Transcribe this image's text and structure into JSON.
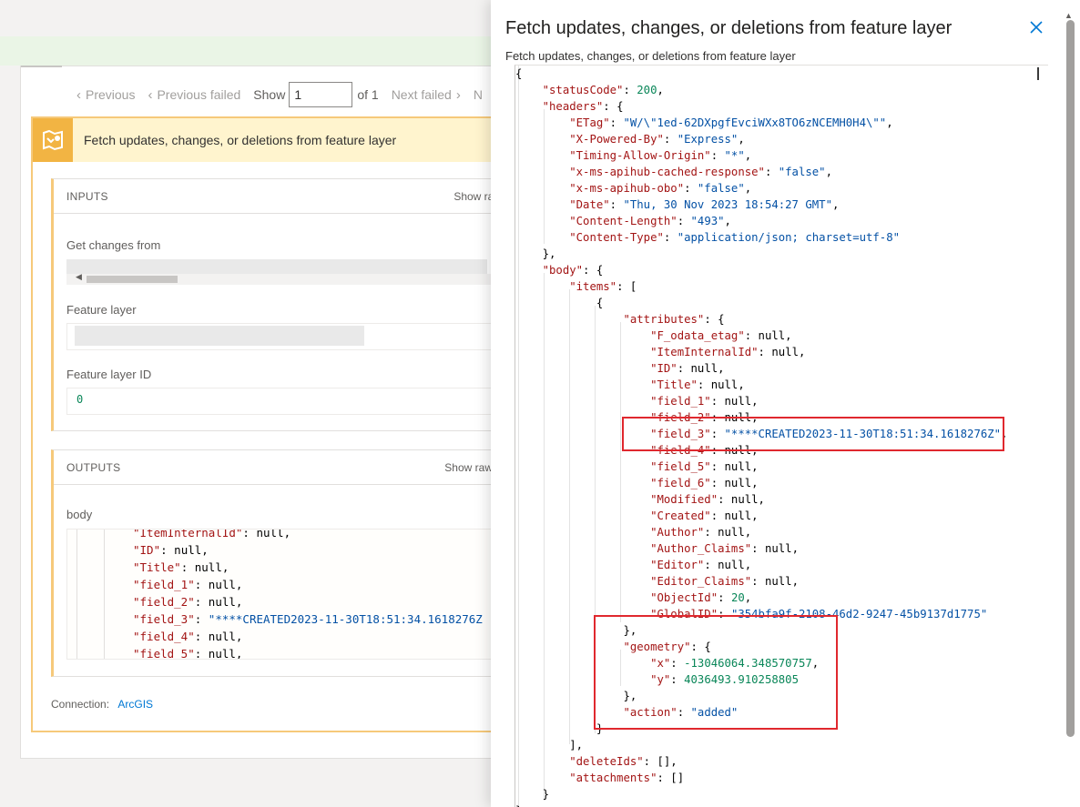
{
  "pager": {
    "previous": "Previous",
    "previous_failed": "Previous failed",
    "show": "Show",
    "page_value": "1",
    "of": "of 1",
    "next_failed": "Next failed",
    "next_partial": "N"
  },
  "action": {
    "title": "Fetch updates, changes, or deletions from feature layer",
    "inputs": {
      "title": "INPUTS",
      "show_raw": "Show raw",
      "fields": {
        "get_changes_from": "Get changes from",
        "feature_layer": "Feature layer",
        "feature_layer_id": "Feature layer ID",
        "feature_layer_id_value": "0"
      }
    },
    "outputs": {
      "title": "OUTPUTS",
      "show_raw": "Show raw o",
      "body_label": "body",
      "code_lines": [
        "\"ItemInternalId\": null,",
        "\"ID\": null,",
        "\"Title\": null,",
        "\"field_1\": null,",
        "\"field_2\": null,",
        "\"field_3\": \"****CREATED2023-11-30T18:51:34.1618276Z",
        "\"field_4\": null,",
        "\"field_5\": null,"
      ]
    },
    "connection_label": "Connection:",
    "connection_value": "ArcGIS"
  },
  "panel": {
    "title": "Fetch updates, changes, or deletions from feature layer",
    "subtitle": "Fetch updates, changes, or deletions from feature layer",
    "close_icon": "close-icon",
    "json_lines": [
      "{",
      "    \"statusCode\": 200,",
      "    \"headers\": {",
      "        \"ETag\": \"W/\\\"1ed-62DXpgfEvciWXx8TO6zNCEMH0H4\\\"\",",
      "        \"X-Powered-By\": \"Express\",",
      "        \"Timing-Allow-Origin\": \"*\",",
      "        \"x-ms-apihub-cached-response\": \"false\",",
      "        \"x-ms-apihub-obo\": \"false\",",
      "        \"Date\": \"Thu, 30 Nov 2023 18:54:27 GMT\",",
      "        \"Content-Length\": \"493\",",
      "        \"Content-Type\": \"application/json; charset=utf-8\"",
      "    },",
      "    \"body\": {",
      "        \"items\": [",
      "            {",
      "                \"attributes\": {",
      "                    \"F_odata_etag\": null,",
      "                    \"ItemInternalId\": null,",
      "                    \"ID\": null,",
      "                    \"Title\": null,",
      "                    \"field_1\": null,",
      "                    \"field_2\": null,",
      "                    \"field_3\": \"****CREATED2023-11-30T18:51:34.1618276Z\",",
      "                    \"field_4\": null,",
      "                    \"field_5\": null,",
      "                    \"field_6\": null,",
      "                    \"Modified\": null,",
      "                    \"Created\": null,",
      "                    \"Author\": null,",
      "                    \"Author_Claims\": null,",
      "                    \"Editor\": null,",
      "                    \"Editor_Claims\": null,",
      "                    \"ObjectId\": 20,",
      "                    \"GlobalID\": \"354bfa9f-2108-46d2-9247-45b9137d1775\"",
      "                },",
      "                \"geometry\": {",
      "                    \"x\": -13046064.348570757,",
      "                    \"y\": 4036493.910258805",
      "                },",
      "                \"action\": \"added\"",
      "            }",
      "        ],",
      "        \"deleteIds\": [],",
      "        \"attachments\": []",
      "    }",
      "}"
    ]
  },
  "colors": {
    "json_key": "#a31515",
    "json_string": "#0451a5",
    "json_number": "#098658",
    "highlight": "#e0282e",
    "action_accent": "#f2b443",
    "link": "#0078d4"
  }
}
